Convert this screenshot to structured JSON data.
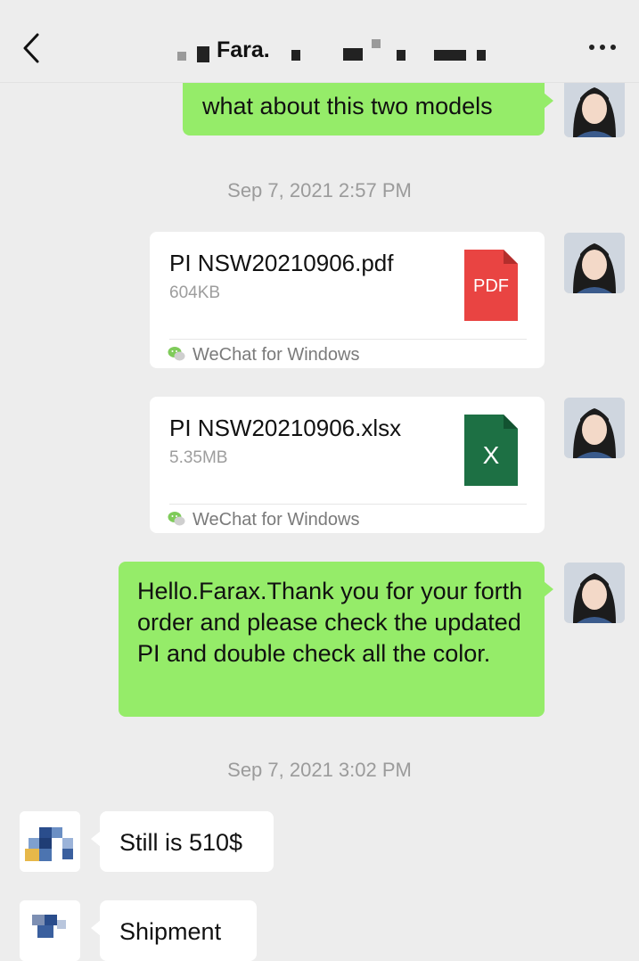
{
  "header": {
    "title": "Fara.",
    "back_icon": "chevron-left-icon",
    "more_icon": "more-dots-icon"
  },
  "messages": {
    "m1": {
      "text": "what about this two models"
    },
    "ts1": "Sep 7, 2021 2:57 PM",
    "file1": {
      "name": "PI NSW20210906.pdf",
      "size": "604KB",
      "source": "WeChat for Windows",
      "icon_label": "PDF",
      "icon_color": "#e94442"
    },
    "file2": {
      "name": "PI NSW20210906.xlsx",
      "size": "5.35MB",
      "source": "WeChat for Windows",
      "icon_label": "X",
      "icon_color": "#1d7044"
    },
    "m2": {
      "text": "Hello.Farax.Thank you for your forth order and please check the updated PI and double check all the color."
    },
    "ts2": "Sep 7, 2021 3:02 PM",
    "m3": {
      "text": "Still is 510$"
    },
    "m4": {
      "text": "Shipment"
    }
  },
  "colors": {
    "background": "#ededed",
    "sent_bubble": "#95ec69",
    "received_bubble": "#ffffff",
    "timestamp": "#9b9b9b"
  }
}
